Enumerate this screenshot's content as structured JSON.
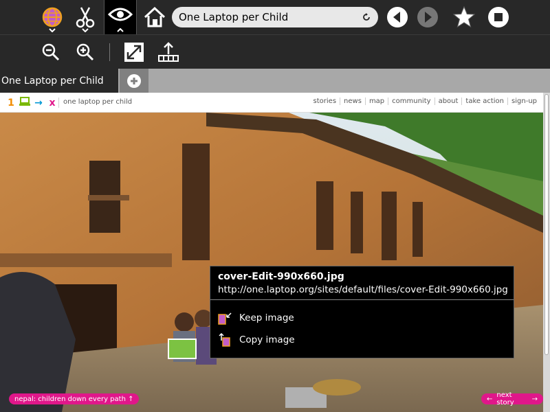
{
  "toolbar": {
    "activity_icon": "globe-icon",
    "edit_icon": "scissors-icon",
    "view_icon": "eye-icon",
    "home_icon": "home-icon",
    "url_value": "One Laptop per Child",
    "reload_icon": "reload-icon",
    "back_icon": "back-arrow-icon",
    "forward_icon": "forward-arrow-icon",
    "bookmark_icon": "star-icon",
    "stop_icon": "stop-icon"
  },
  "view_toolbar": {
    "zoom_out_icon": "zoom-out-icon",
    "zoom_in_icon": "zoom-in-icon",
    "fullscreen_icon": "fullscreen-icon",
    "share_icon": "upload-icon"
  },
  "tabs": [
    {
      "label": "One Laptop per Child"
    }
  ],
  "site": {
    "logo_glyphs": [
      "1",
      "",
      "→",
      "x"
    ],
    "name": "one laptop per child",
    "nav": [
      "stories",
      "news",
      "map",
      "community",
      "about",
      "take action",
      "sign-up"
    ],
    "caption": "nepal: children down every path ↑",
    "next_story": "next story"
  },
  "palette": {
    "title": "cover-Edit-990x660.jpg",
    "url": "http://one.laptop.org/sites/default/files/cover-Edit-990x660.jpg",
    "items": [
      {
        "label": "Keep image",
        "icon": "keep-image-icon"
      },
      {
        "label": "Copy image",
        "icon": "copy-image-icon"
      }
    ]
  },
  "colors": {
    "toolbar_bg": "#282828",
    "accent_pink": "#e0178a",
    "url_field": "#e8e8e8"
  }
}
